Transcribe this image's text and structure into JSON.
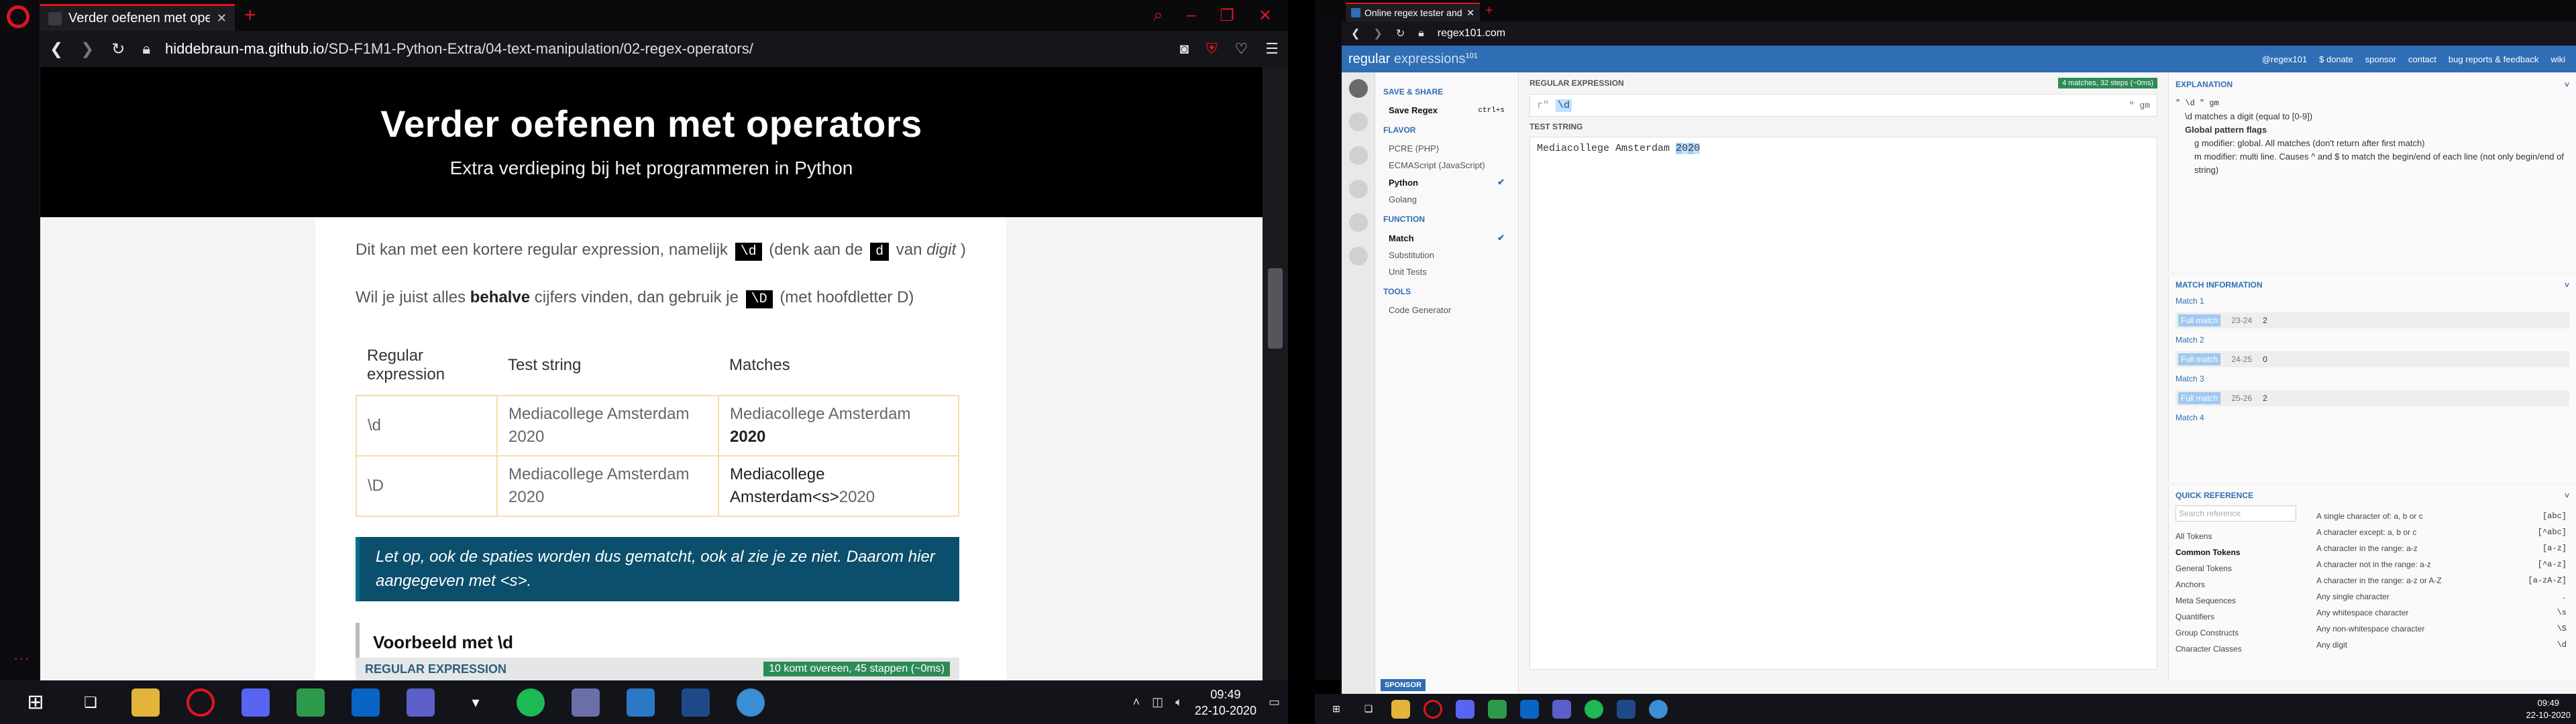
{
  "left": {
    "tab_title": "Verder oefenen met operators",
    "url_host": "hiddebraun-ma.github.io",
    "url_path": "/SD-F1M1-Python-Extra/04-text-manipulation/02-regex-operators/",
    "hero_title": "Verder oefenen met operators",
    "hero_subtitle": "Extra verdieping bij het programmeren in Python",
    "p1_a": "Dit kan met een kortere regular expression, namelijk",
    "p1_code": "\\d",
    "p1_b": "(denk aan de",
    "p1_code2": "d",
    "p1_c": "van",
    "p1_em": "digit",
    "p1_d": ")",
    "p2_a": "Wil je juist alles",
    "p2_strong": "behalve",
    "p2_b": "cijfers vinden, dan gebruik je",
    "p2_code": "\\D",
    "p2_c": "(met hoofdletter D)",
    "table_headers": [
      "Regular expression",
      "Test string",
      "Matches"
    ],
    "row1": {
      "regex": "\\d",
      "test": "Mediacollege Amsterdam 2020",
      "match_plain": "Mediacollege Amsterdam ",
      "match_bold": "2020"
    },
    "row2": {
      "regex": "\\D",
      "test": "Mediacollege Amsterdam 2020",
      "match_bold": "Mediacollege Amsterdam<s>",
      "match_plain": "2020"
    },
    "note": "Let op, ook de spaties worden dus gematcht, ook al zie je ze niet. Daarom hier aangegeven met <s>.",
    "heading": "Voorbeeld met \\d",
    "regex_strip_label": "REGULAR EXPRESSION",
    "regex_strip_badge": "10 komt overeen, 45 stappen (~0ms)",
    "clock_time": "09:49",
    "clock_date": "22-10-2020"
  },
  "right": {
    "tab_title": "Online regex tester and debugger",
    "url": "regex101.com",
    "logo_a": "regular",
    "logo_b": " expressions",
    "logo_c": "101",
    "links": [
      "@regex101",
      "$ donate",
      "sponsor",
      "contact",
      "bug reports & feedback",
      "wiki"
    ],
    "save_share": "SAVE & SHARE",
    "save_regex": "Save Regex",
    "save_shortcut": "ctrl+s",
    "flavor": "FLAVOR",
    "flavors": [
      "PCRE (PHP)",
      "ECMAScript (JavaScript)",
      "Python",
      "Golang"
    ],
    "function": "FUNCTION",
    "functions": [
      "Match",
      "Substitution",
      "Unit Tests"
    ],
    "tools": "TOOLS",
    "code_generator": "Code Generator",
    "sponsor": "SPONSOR",
    "regex_label": "REGULAR EXPRESSION",
    "regex_info": "4 matches, 32 steps (~0ms)",
    "regex_delim": "r\"",
    "regex_value": "\\d",
    "regex_flags": "\" gm",
    "test_label": "TEST STRING",
    "test_a": "Mediacollege Amsterdam ",
    "test_d1": "2",
    "test_d2": "0",
    "test_d3": "2",
    "test_d4": "0",
    "explanation": "EXPLANATION",
    "expl_line1": "\" \\d \" gm",
    "expl_line2": "\\d matches a digit (equal to [0-9])",
    "expl_line3": "Global pattern flags",
    "expl_line4": "g modifier: global. All matches (don't return after first match)",
    "expl_line5": "m modifier: multi line. Causes ^ and $ to match the begin/end of each line (not only begin/end of string)",
    "match_info": "MATCH INFORMATION",
    "matches": [
      {
        "group": "Match 1",
        "label": "Full match",
        "pos": "23-24",
        "val": "2"
      },
      {
        "group": "Match 2",
        "label": "Full match",
        "pos": "24-25",
        "val": "0"
      },
      {
        "group": "Match 3",
        "label": "Full match",
        "pos": "25-26",
        "val": "2"
      }
    ],
    "match4": "Match 4",
    "quick_ref": "QUICK REFERENCE",
    "search_placeholder": "Search reference",
    "categories": [
      "All Tokens",
      "Common Tokens",
      "General Tokens",
      "Anchors",
      "Meta Sequences",
      "Quantifiers",
      "Group Constructs",
      "Character Classes"
    ],
    "refs": [
      {
        "d": "A single character of: a, b or c",
        "t": "[abc]"
      },
      {
        "d": "A character except: a, b or c",
        "t": "[^abc]"
      },
      {
        "d": "A character in the range: a-z",
        "t": "[a-z]"
      },
      {
        "d": "A character not in the range: a-z",
        "t": "[^a-z]"
      },
      {
        "d": "A character in the range: a-z or A-Z",
        "t": "[a-zA-Z]"
      },
      {
        "d": "Any single character",
        "t": "."
      },
      {
        "d": "Any whitespace character",
        "t": "\\s"
      },
      {
        "d": "Any non-whitespace character",
        "t": "\\S"
      },
      {
        "d": "Any digit",
        "t": "\\d"
      }
    ],
    "clock_time": "09:49",
    "clock_date": "22-10-2020"
  },
  "colors": {
    "opera_red": "#e0141e",
    "regex101_blue": "#2f6db5",
    "note_bg": "#0b4f6c"
  }
}
